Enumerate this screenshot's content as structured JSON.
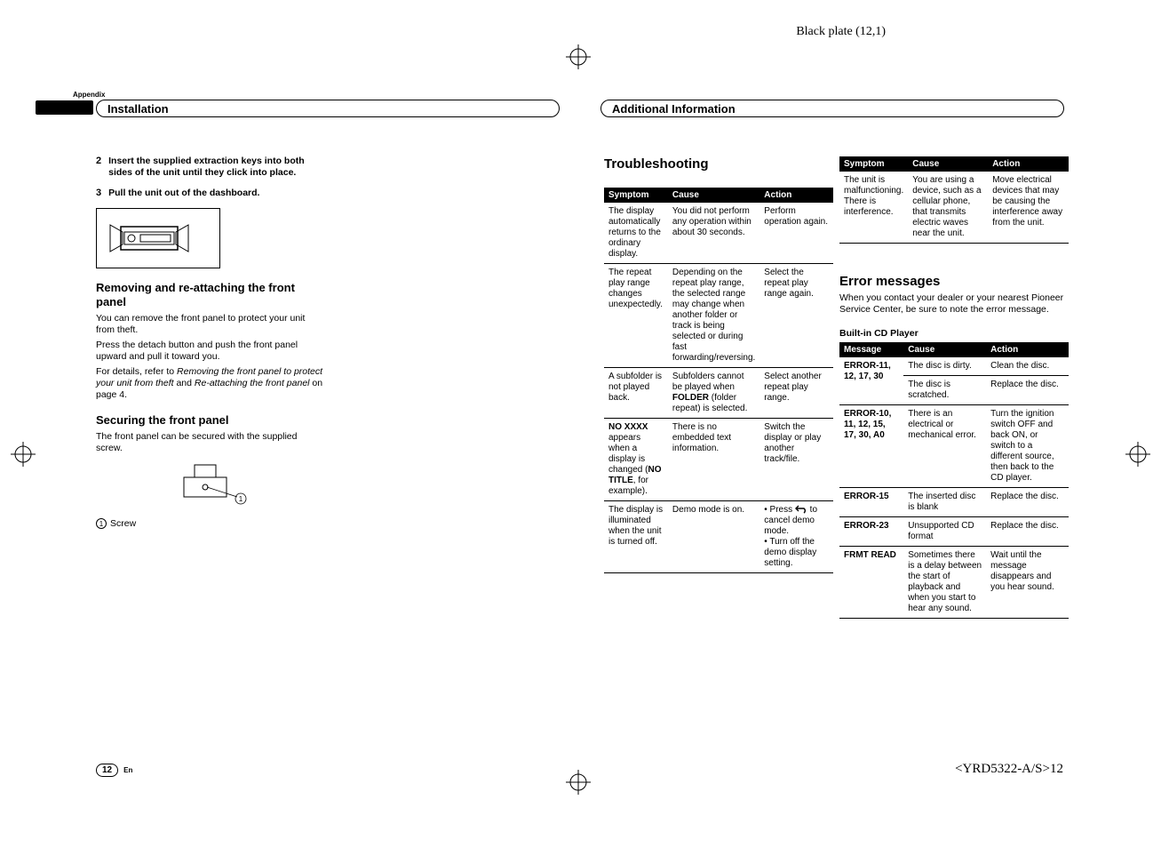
{
  "plate_info": "Black plate (12,1)",
  "appendix_label": "Appendix",
  "sections": {
    "installation": "Installation",
    "additional": "Additional Information"
  },
  "left": {
    "step2_num": "2",
    "step2_text": "Insert the supplied extraction keys into both sides of the unit until they click into place.",
    "step3_num": "3",
    "step3_text": "Pull the unit out of the dashboard.",
    "removing_heading": "Removing and re-attaching the front panel",
    "removing_p1": "You can remove the front panel to protect your unit from theft.",
    "removing_p2": "Press the detach button and push the front panel upward and pull it toward you.",
    "removing_p3a": "For details, refer to ",
    "removing_p3i1": "Removing the front panel to protect your unit from theft",
    "removing_p3b": " and ",
    "removing_p3i2": "Re-attaching the front panel",
    "removing_p3c": " on page 4.",
    "securing_heading": "Securing the front panel",
    "securing_p": "The front panel can be secured with the supplied screw.",
    "callout_num": "1",
    "callout_text": "Screw"
  },
  "troubleshooting_heading": "Troubleshooting",
  "table1": {
    "head": {
      "c1": "Symptom",
      "c2": "Cause",
      "c3": "Action"
    },
    "rows": [
      {
        "c1": "The display automatically returns to the ordinary display.",
        "c2": "You did not perform any operation within about 30 seconds.",
        "c3": "Perform operation again."
      },
      {
        "c1": "The repeat play range changes unexpectedly.",
        "c2": "Depending on the repeat play range, the selected range may change when another folder or track is being selected or during fast forwarding/reversing.",
        "c3": "Select the repeat play range again."
      },
      {
        "c1": "A subfolder is not played back.",
        "c2_a": "Subfolders cannot be played when ",
        "c2_b": "FOLDER",
        "c2_c": " (folder repeat) is selected.",
        "c3": "Select another repeat play range."
      },
      {
        "c1_a": "NO XXXX",
        "c1_b": " appears when a display is changed (",
        "c1_c": "NO TITLE",
        "c1_d": ", for example).",
        "c2": "There is no embedded text information.",
        "c3": "Switch the display or play another track/file."
      },
      {
        "c1": "The display is illuminated when the unit is turned off.",
        "c2": "Demo mode is on.",
        "c3_a": "• Press ",
        "c3_b": " to cancel demo mode.",
        "c3_c": "• Turn off the demo display setting."
      }
    ]
  },
  "table2": {
    "head": {
      "c1": "Symptom",
      "c2": "Cause",
      "c3": "Action"
    },
    "rows": [
      {
        "c1": "The unit is malfunctioning.\nThere is interference.",
        "c2": "You are using a device, such as a cellular phone, that transmits electric waves near the unit.",
        "c3": "Move electrical devices that may be causing the interference away from the unit."
      }
    ]
  },
  "error_heading": "Error messages",
  "error_sub": "When you contact your dealer or your nearest Pioneer Service Center, be sure to note the error message.",
  "player_label": "Built-in CD Player",
  "table3": {
    "head": {
      "c1": "Message",
      "c2": "Cause",
      "c3": "Action"
    },
    "rows": [
      {
        "c1": "ERROR-11, 12, 17, 30",
        "c2": "The disc is dirty.",
        "c3": "Clean the disc."
      },
      {
        "c1": "",
        "c2": "The disc is scratched.",
        "c3": "Replace the disc."
      },
      {
        "c1": "ERROR-10, 11, 12, 15, 17, 30, A0",
        "c2": "There is an electrical or mechanical error.",
        "c3": "Turn the ignition switch OFF and back ON, or switch to a different source, then back to the CD player."
      },
      {
        "c1": "ERROR-15",
        "c2": "The inserted disc is blank",
        "c3": "Replace the disc."
      },
      {
        "c1": "ERROR-23",
        "c2": "Unsupported CD format",
        "c3": "Replace the disc."
      },
      {
        "c1": "FRMT READ",
        "c2": "Sometimes there is a delay between the start of playback and when you start to hear any sound.",
        "c3": "Wait until the message disappears and you hear sound."
      }
    ]
  },
  "footer": {
    "page": "12",
    "lang": "En",
    "doc_code": "<YRD5322-A/S>12"
  }
}
